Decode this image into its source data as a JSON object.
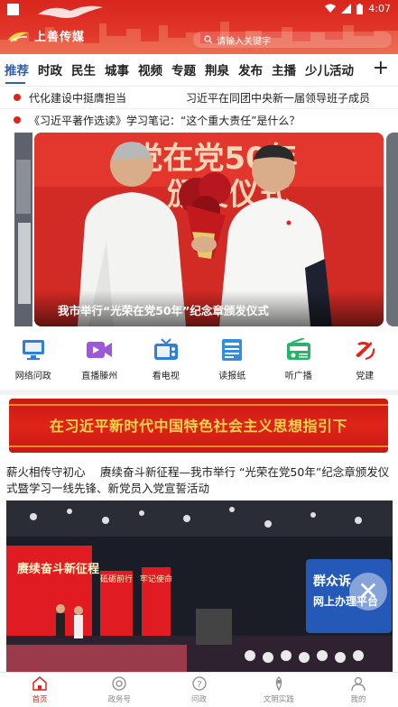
{
  "status_bar": {
    "time": "4:07"
  },
  "header": {
    "logo_text": "上善传媒",
    "search_placeholder": "请输入关键字"
  },
  "tabs": [
    "推荐",
    "时政",
    "民生",
    "城事",
    "视频",
    "专题",
    "荆泉",
    "发布",
    "主播",
    "少儿活动"
  ],
  "active_tab": 0,
  "ticker": [
    {
      "left": "代化建设中挺膺担当",
      "right": "习近平在同团中央新一届领导班子成员"
    },
    {
      "left": "《习近平著作选读》学习笔记：“这个重大责任”是什么？",
      "right": ""
    }
  ],
  "carousel": {
    "caption": "我市举行“光荣在党50年”纪念章颁发仪式",
    "backdrop_line1": "党在党50年",
    "backdrop_line2": "颁发仪式"
  },
  "quick_links": [
    {
      "label": "网络问政",
      "icon": "monitor-icon",
      "color": "#2f7fd8"
    },
    {
      "label": "直播滕州",
      "icon": "video-camera-icon",
      "color": "#9b59d6"
    },
    {
      "label": "看电视",
      "icon": "tv-icon",
      "color": "#2f7fd8"
    },
    {
      "label": "读报纸",
      "icon": "newspaper-icon",
      "color": "#2f8fe0"
    },
    {
      "label": "听广播",
      "icon": "radio-icon",
      "color": "#27b36a"
    },
    {
      "label": "党建",
      "icon": "party-emblem-icon",
      "color": "#e0241a"
    }
  ],
  "banner": {
    "text": "在习近平新时代中国特色社会主义思想指引下"
  },
  "news": {
    "title": "薪火相传守初心　 赓续奋斗新征程—我市举行 “光荣在党50年”纪念章颁发仪式暨学习一线先锋、新党员入党宣誓活动",
    "stage_board": "赓续奋斗新征程",
    "stage_panel_1": "砥砺前行",
    "stage_panel_2": "牢记使命",
    "overlay_line1": "群众诉",
    "overlay_line2": "网上办理平台"
  },
  "bottom_nav": [
    {
      "label": "首页",
      "icon": "home-icon"
    },
    {
      "label": "政务号",
      "icon": "government-icon"
    },
    {
      "label": "问政",
      "icon": "question-icon"
    },
    {
      "label": "文明实践",
      "icon": "civilization-icon"
    },
    {
      "label": "我的",
      "icon": "user-icon"
    }
  ],
  "colors": {
    "brand_red": "#d8261c",
    "tab_active": "#2f5fb3",
    "banner_text": "#f7d44a"
  }
}
